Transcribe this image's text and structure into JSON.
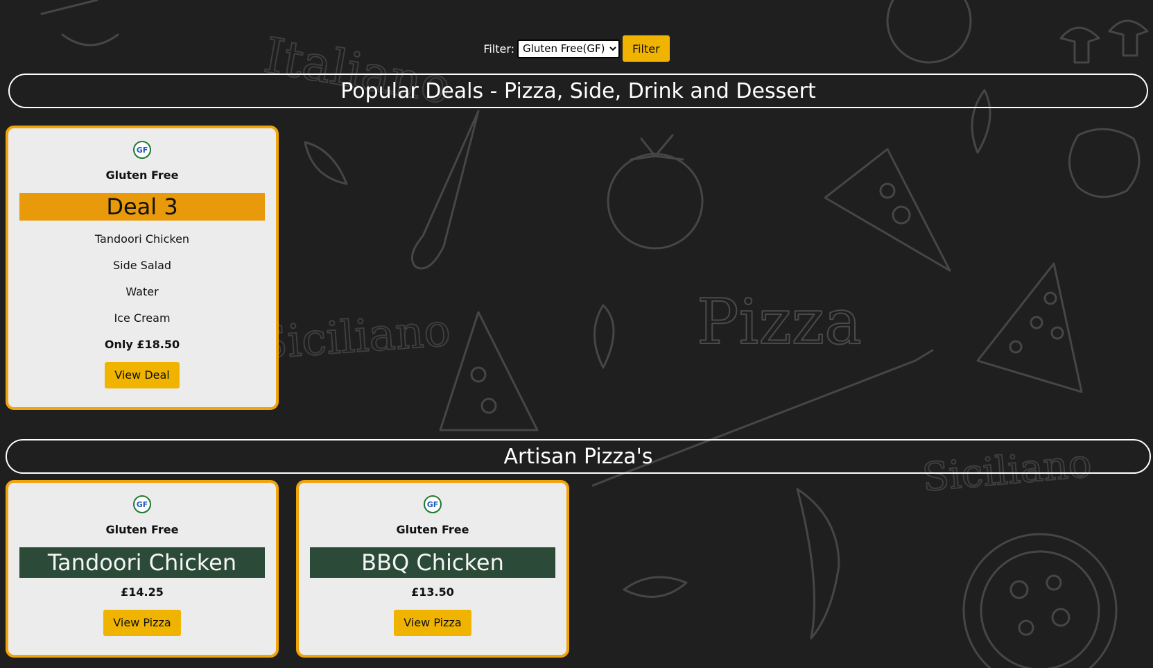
{
  "filter": {
    "label": "Filter:",
    "selected_option": "Gluten Free(GF)",
    "button_label": "Filter"
  },
  "sections": {
    "deals_title": "Popular Deals - Pizza, Side, Drink and Dessert",
    "pizzas_title": "Artisan Pizza's"
  },
  "deal_card": {
    "badge_icon": "gf-icon",
    "badge_text": "GF",
    "badge_label": "Gluten Free",
    "title": "Deal 3",
    "items": [
      "Tandoori Chicken",
      "Side Salad",
      "Water",
      "Ice Cream"
    ],
    "price": "Only £18.50",
    "button_label": "View Deal"
  },
  "pizza_cards": [
    {
      "badge_icon": "gf-icon",
      "badge_text": "GF",
      "badge_label": "Gluten Free",
      "title": "Tandoori Chicken",
      "price": "£14.25",
      "button_label": "View Pizza"
    },
    {
      "badge_icon": "gf-icon",
      "badge_text": "GF",
      "badge_label": "Gluten Free",
      "title": "BBQ Chicken",
      "price": "£13.50",
      "button_label": "View Pizza"
    }
  ],
  "background_doodles": {
    "words": [
      "Italiano",
      "Pizza",
      "Siciliano",
      "Siciliano"
    ]
  },
  "colors": {
    "background": "#1f1f1f",
    "accent_orange": "#f0a30a",
    "button_yellow": "#f0b400",
    "deal_banner": "#e89a0a",
    "pizza_banner": "#2b4a37",
    "card_bg": "#ececec",
    "gf_green": "#1e7a34",
    "gf_blue": "#1e5bbf"
  }
}
